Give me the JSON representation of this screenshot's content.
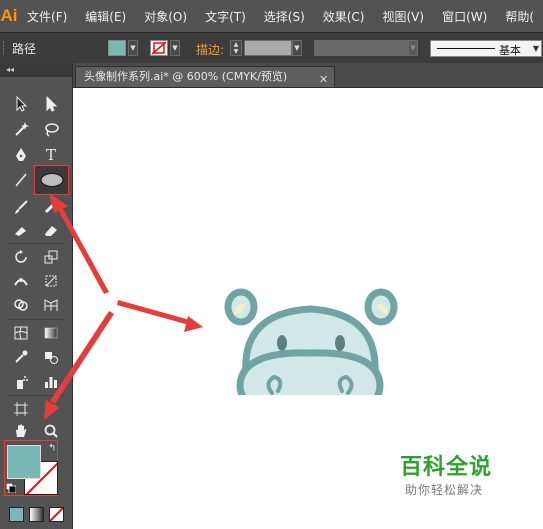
{
  "app": {
    "logo": "Ai"
  },
  "menu": [
    "文件(F)",
    "编辑(E)",
    "对象(O)",
    "文字(T)",
    "选择(S)",
    "效果(C)",
    "视图(V)",
    "窗口(W)",
    "帮助("
  ],
  "control_bar": {
    "selection_label": "路径",
    "stroke_label": "描边:",
    "stroke_style": "基本"
  },
  "document_tab": {
    "title": "头像制作系列.ai* @ 600% (CMYK/预览)",
    "close": "✕"
  },
  "toolbox": {
    "collapse_glyph": "◂◂",
    "type_tool": "T"
  },
  "colors": {
    "fill": "#7ab8b7",
    "hippo_fill": "#d2e7e7",
    "hippo_stroke": "#6fa4a3",
    "ear_inner": "#f3f0c6",
    "highlight": "#e54040",
    "watermark_green": "#2fa12e"
  },
  "watermark": {
    "title": "百科全说",
    "subtitle": "助你轻松解决"
  }
}
